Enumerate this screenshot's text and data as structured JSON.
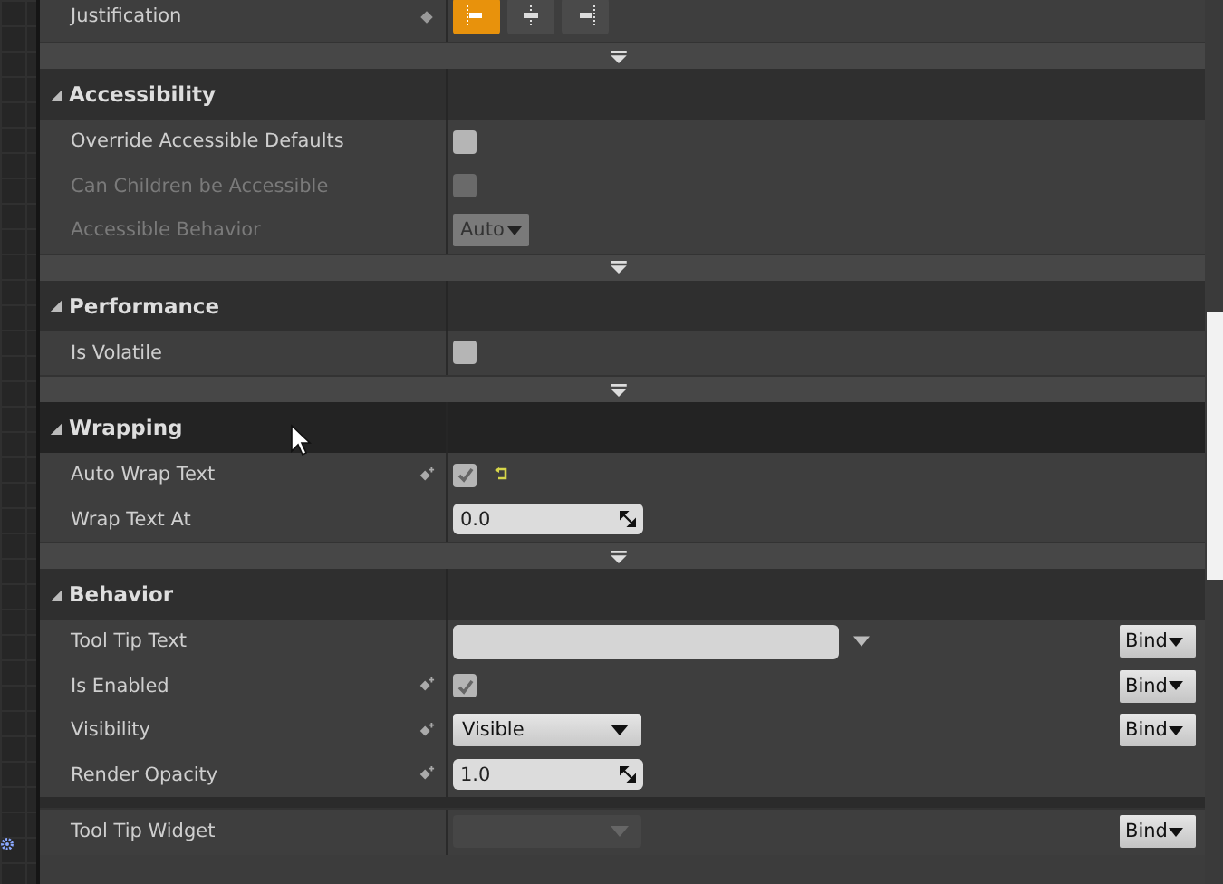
{
  "justification": {
    "label": "Justification",
    "options": [
      {
        "kind": "left",
        "selected": true
      },
      {
        "kind": "center",
        "selected": false
      },
      {
        "kind": "right",
        "selected": false
      }
    ]
  },
  "sections": [
    {
      "title": "Accessibility",
      "expanded": true,
      "hovered": false,
      "advanced_toggle": true,
      "rows": [
        {
          "kind": "checkbox",
          "label": "Override Accessible Defaults",
          "disabled": false,
          "bindable": false,
          "checked": false
        },
        {
          "kind": "checkbox",
          "label": "Can Children be Accessible",
          "disabled": true,
          "bindable": false,
          "checked": false
        },
        {
          "kind": "enum",
          "label": "Accessible Behavior",
          "disabled": true,
          "bindable": false,
          "value": "Auto"
        }
      ]
    },
    {
      "title": "Performance",
      "expanded": true,
      "hovered": false,
      "advanced_toggle": true,
      "rows": [
        {
          "kind": "checkbox",
          "label": "Is Volatile",
          "disabled": false,
          "bindable": false,
          "checked": false
        }
      ]
    },
    {
      "title": "Wrapping",
      "expanded": true,
      "hovered": true,
      "advanced_toggle": true,
      "rows": [
        {
          "kind": "checkbox",
          "label": "Auto Wrap Text",
          "disabled": false,
          "bindable": true,
          "checked": true,
          "reset": true
        },
        {
          "kind": "number",
          "label": "Wrap Text At",
          "disabled": false,
          "bindable": false,
          "value": "0.0"
        }
      ]
    },
    {
      "title": "Behavior",
      "expanded": true,
      "hovered": false,
      "advanced_toggle": false,
      "rows": [
        {
          "kind": "text",
          "label": "Tool Tip Text",
          "disabled": false,
          "bindable": false,
          "bind": "Bind"
        },
        {
          "kind": "checkbox",
          "label": "Is Enabled",
          "disabled": false,
          "bindable": true,
          "checked": true,
          "bind": "Bind"
        },
        {
          "kind": "dropdown",
          "label": "Visibility",
          "disabled": false,
          "bindable": true,
          "value": "Visible",
          "bind": "Bind"
        },
        {
          "kind": "number",
          "label": "Render Opacity",
          "disabled": false,
          "bindable": true,
          "value": "1.0"
        },
        {
          "kind": "separator"
        },
        {
          "kind": "dropdown",
          "label": "Tool Tip Widget",
          "disabled": false,
          "field_disabled": true,
          "bindable": false,
          "bind": "Bind"
        }
      ]
    }
  ]
}
